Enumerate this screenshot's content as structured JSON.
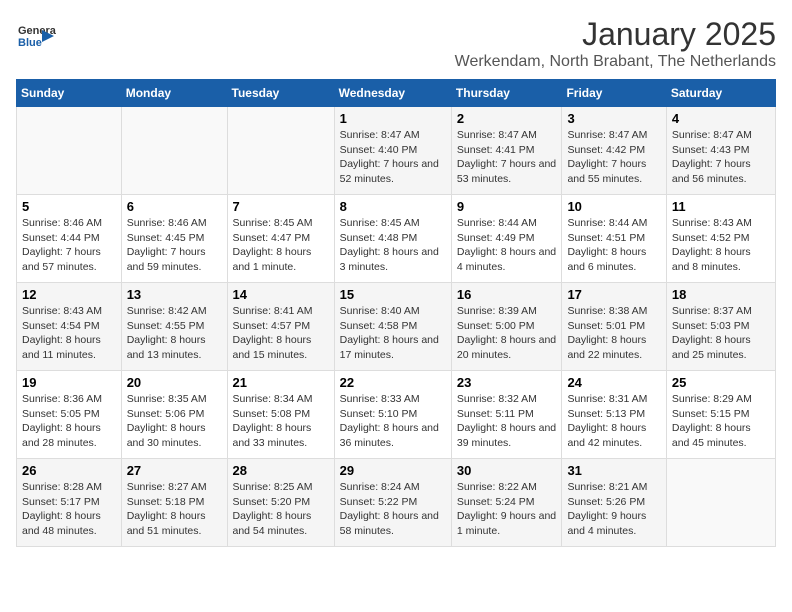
{
  "logo": {
    "general": "General",
    "blue": "Blue"
  },
  "title": "January 2025",
  "subtitle": "Werkendam, North Brabant, The Netherlands",
  "days_of_week": [
    "Sunday",
    "Monday",
    "Tuesday",
    "Wednesday",
    "Thursday",
    "Friday",
    "Saturday"
  ],
  "weeks": [
    [
      {
        "day": "",
        "info": ""
      },
      {
        "day": "",
        "info": ""
      },
      {
        "day": "",
        "info": ""
      },
      {
        "day": "1",
        "info": "Sunrise: 8:47 AM\nSunset: 4:40 PM\nDaylight: 7 hours and 52 minutes."
      },
      {
        "day": "2",
        "info": "Sunrise: 8:47 AM\nSunset: 4:41 PM\nDaylight: 7 hours and 53 minutes."
      },
      {
        "day": "3",
        "info": "Sunrise: 8:47 AM\nSunset: 4:42 PM\nDaylight: 7 hours and 55 minutes."
      },
      {
        "day": "4",
        "info": "Sunrise: 8:47 AM\nSunset: 4:43 PM\nDaylight: 7 hours and 56 minutes."
      }
    ],
    [
      {
        "day": "5",
        "info": "Sunrise: 8:46 AM\nSunset: 4:44 PM\nDaylight: 7 hours and 57 minutes."
      },
      {
        "day": "6",
        "info": "Sunrise: 8:46 AM\nSunset: 4:45 PM\nDaylight: 7 hours and 59 minutes."
      },
      {
        "day": "7",
        "info": "Sunrise: 8:45 AM\nSunset: 4:47 PM\nDaylight: 8 hours and 1 minute."
      },
      {
        "day": "8",
        "info": "Sunrise: 8:45 AM\nSunset: 4:48 PM\nDaylight: 8 hours and 3 minutes."
      },
      {
        "day": "9",
        "info": "Sunrise: 8:44 AM\nSunset: 4:49 PM\nDaylight: 8 hours and 4 minutes."
      },
      {
        "day": "10",
        "info": "Sunrise: 8:44 AM\nSunset: 4:51 PM\nDaylight: 8 hours and 6 minutes."
      },
      {
        "day": "11",
        "info": "Sunrise: 8:43 AM\nSunset: 4:52 PM\nDaylight: 8 hours and 8 minutes."
      }
    ],
    [
      {
        "day": "12",
        "info": "Sunrise: 8:43 AM\nSunset: 4:54 PM\nDaylight: 8 hours and 11 minutes."
      },
      {
        "day": "13",
        "info": "Sunrise: 8:42 AM\nSunset: 4:55 PM\nDaylight: 8 hours and 13 minutes."
      },
      {
        "day": "14",
        "info": "Sunrise: 8:41 AM\nSunset: 4:57 PM\nDaylight: 8 hours and 15 minutes."
      },
      {
        "day": "15",
        "info": "Sunrise: 8:40 AM\nSunset: 4:58 PM\nDaylight: 8 hours and 17 minutes."
      },
      {
        "day": "16",
        "info": "Sunrise: 8:39 AM\nSunset: 5:00 PM\nDaylight: 8 hours and 20 minutes."
      },
      {
        "day": "17",
        "info": "Sunrise: 8:38 AM\nSunset: 5:01 PM\nDaylight: 8 hours and 22 minutes."
      },
      {
        "day": "18",
        "info": "Sunrise: 8:37 AM\nSunset: 5:03 PM\nDaylight: 8 hours and 25 minutes."
      }
    ],
    [
      {
        "day": "19",
        "info": "Sunrise: 8:36 AM\nSunset: 5:05 PM\nDaylight: 8 hours and 28 minutes."
      },
      {
        "day": "20",
        "info": "Sunrise: 8:35 AM\nSunset: 5:06 PM\nDaylight: 8 hours and 30 minutes."
      },
      {
        "day": "21",
        "info": "Sunrise: 8:34 AM\nSunset: 5:08 PM\nDaylight: 8 hours and 33 minutes."
      },
      {
        "day": "22",
        "info": "Sunrise: 8:33 AM\nSunset: 5:10 PM\nDaylight: 8 hours and 36 minutes."
      },
      {
        "day": "23",
        "info": "Sunrise: 8:32 AM\nSunset: 5:11 PM\nDaylight: 8 hours and 39 minutes."
      },
      {
        "day": "24",
        "info": "Sunrise: 8:31 AM\nSunset: 5:13 PM\nDaylight: 8 hours and 42 minutes."
      },
      {
        "day": "25",
        "info": "Sunrise: 8:29 AM\nSunset: 5:15 PM\nDaylight: 8 hours and 45 minutes."
      }
    ],
    [
      {
        "day": "26",
        "info": "Sunrise: 8:28 AM\nSunset: 5:17 PM\nDaylight: 8 hours and 48 minutes."
      },
      {
        "day": "27",
        "info": "Sunrise: 8:27 AM\nSunset: 5:18 PM\nDaylight: 8 hours and 51 minutes."
      },
      {
        "day": "28",
        "info": "Sunrise: 8:25 AM\nSunset: 5:20 PM\nDaylight: 8 hours and 54 minutes."
      },
      {
        "day": "29",
        "info": "Sunrise: 8:24 AM\nSunset: 5:22 PM\nDaylight: 8 hours and 58 minutes."
      },
      {
        "day": "30",
        "info": "Sunrise: 8:22 AM\nSunset: 5:24 PM\nDaylight: 9 hours and 1 minute."
      },
      {
        "day": "31",
        "info": "Sunrise: 8:21 AM\nSunset: 5:26 PM\nDaylight: 9 hours and 4 minutes."
      },
      {
        "day": "",
        "info": ""
      }
    ]
  ]
}
